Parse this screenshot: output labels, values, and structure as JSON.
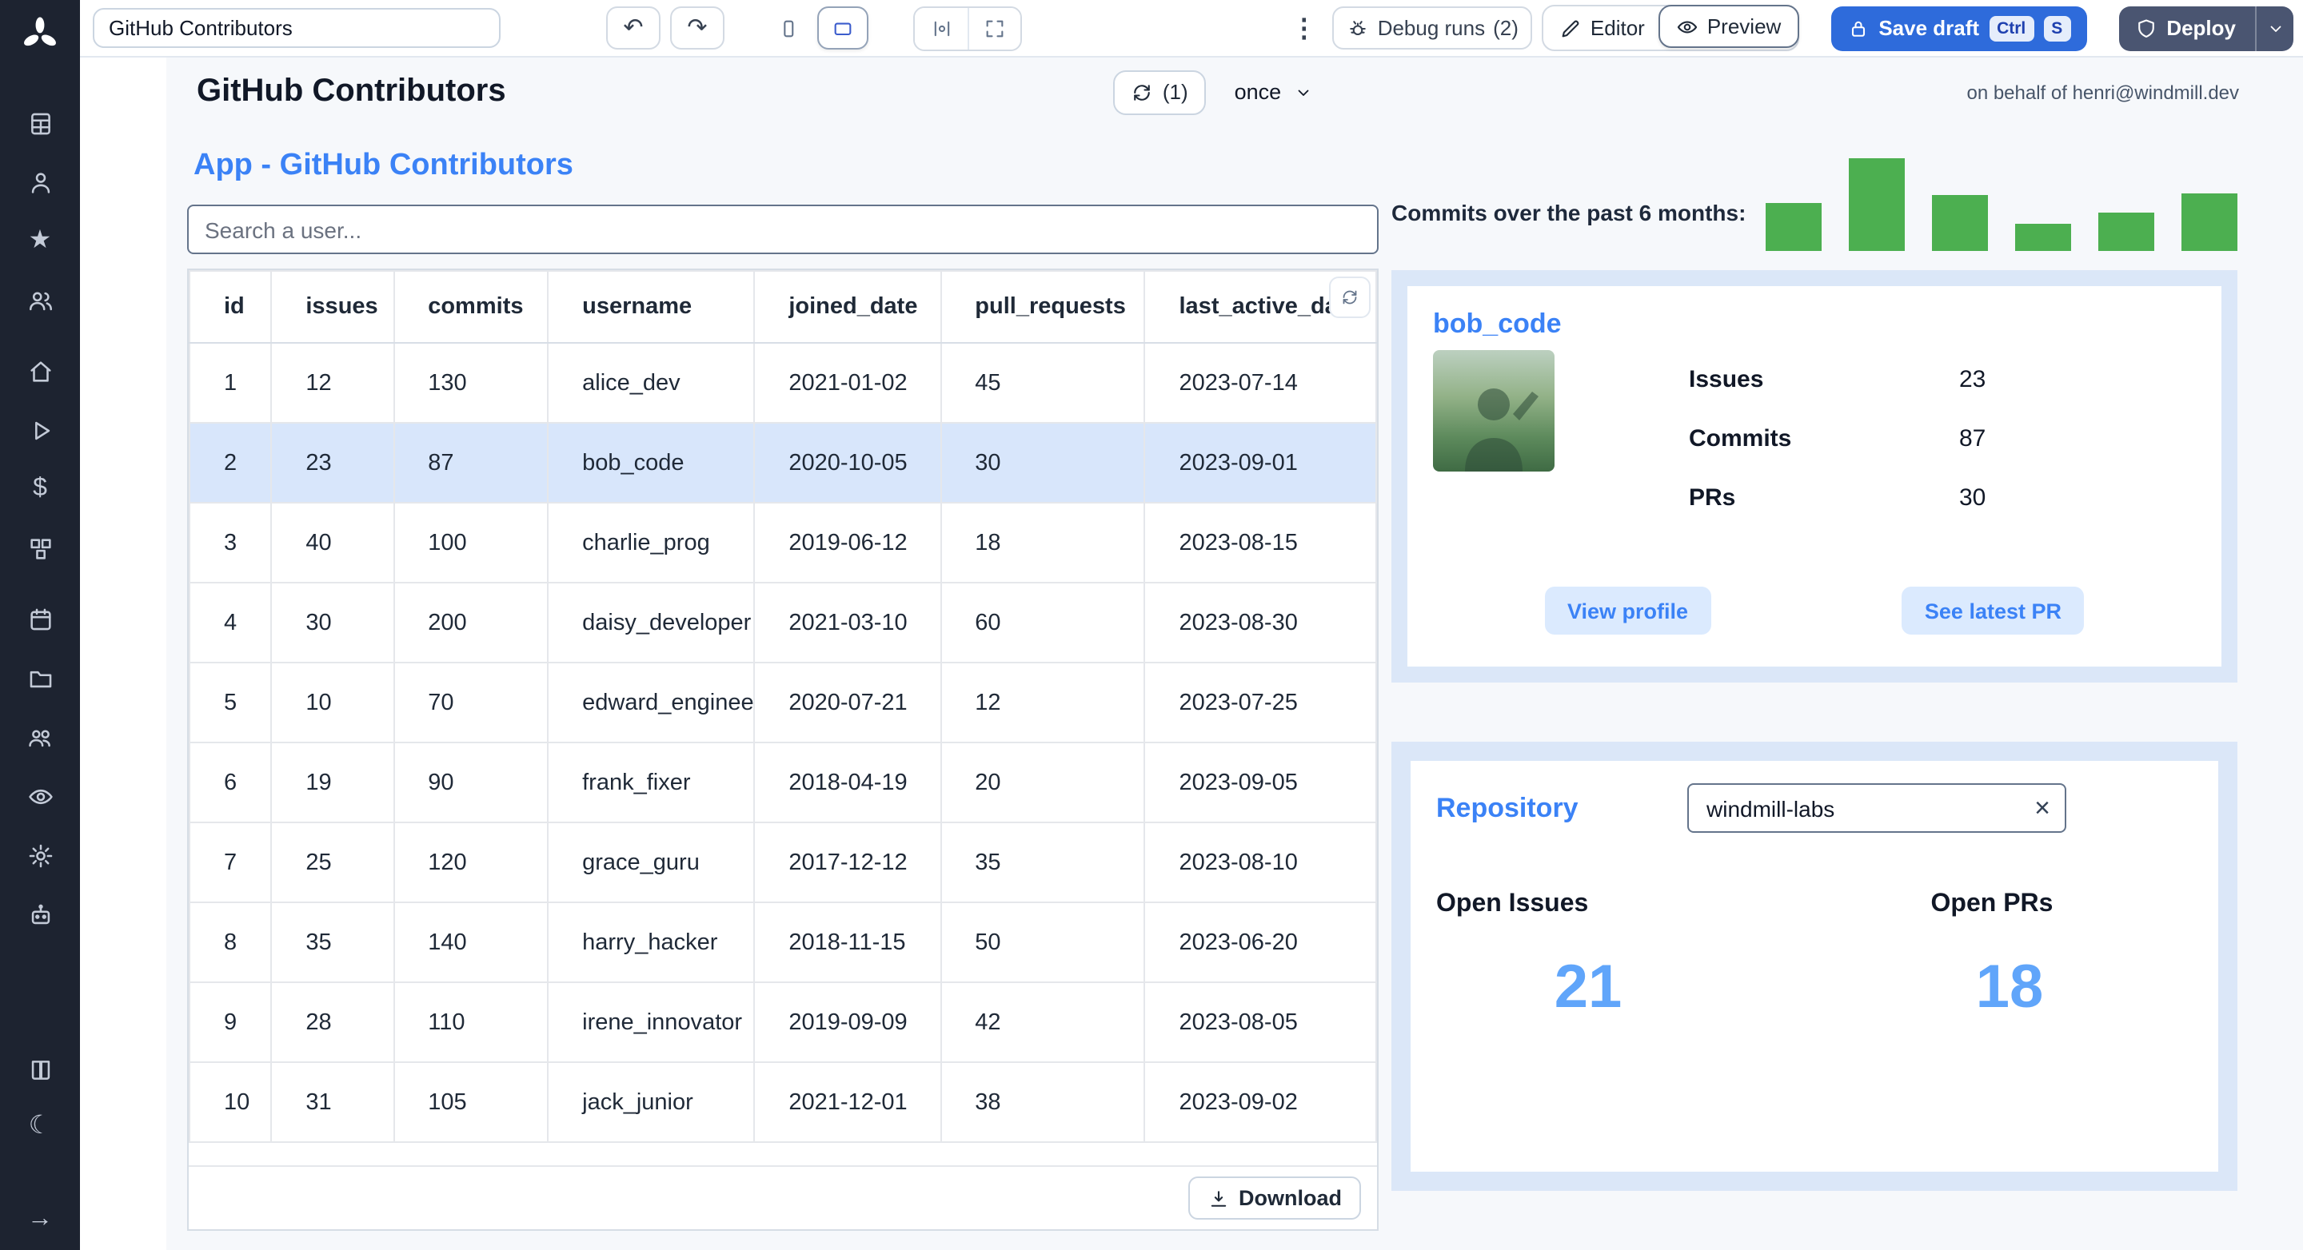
{
  "toolbar": {
    "app_title_value": "GitHub Contributors",
    "debug_runs_label": "Debug runs",
    "debug_runs_count": "(2)",
    "editor_label": "Editor",
    "preview_label": "Preview",
    "save_draft_label": "Save draft",
    "kbd_ctrl": "Ctrl",
    "kbd_s": "S",
    "deploy_label": "Deploy"
  },
  "header": {
    "title": "GitHub Contributors",
    "refresh_count": "(1)",
    "schedule_label": "once",
    "on_behalf": "on behalf of henri@windmill.dev"
  },
  "main": {
    "section_title": "App - GitHub Contributors",
    "search_placeholder": "Search a user...",
    "download_label": "Download"
  },
  "table": {
    "columns": [
      "id",
      "issues",
      "commits",
      "username",
      "joined_date",
      "pull_requests",
      "last_active_date"
    ],
    "selected_row_index": 1,
    "rows": [
      [
        "1",
        "12",
        "130",
        "alice_dev",
        "2021-01-02",
        "45",
        "2023-07-14"
      ],
      [
        "2",
        "23",
        "87",
        "bob_code",
        "2020-10-05",
        "30",
        "2023-09-01"
      ],
      [
        "3",
        "40",
        "100",
        "charlie_prog",
        "2019-06-12",
        "18",
        "2023-08-15"
      ],
      [
        "4",
        "30",
        "200",
        "daisy_developer",
        "2021-03-10",
        "60",
        "2023-08-30"
      ],
      [
        "5",
        "10",
        "70",
        "edward_engineer",
        "2020-07-21",
        "12",
        "2023-07-25"
      ],
      [
        "6",
        "19",
        "90",
        "frank_fixer",
        "2018-04-19",
        "20",
        "2023-09-05"
      ],
      [
        "7",
        "25",
        "120",
        "grace_guru",
        "2017-12-12",
        "35",
        "2023-08-10"
      ],
      [
        "8",
        "35",
        "140",
        "harry_hacker",
        "2018-11-15",
        "50",
        "2023-06-20"
      ],
      [
        "9",
        "28",
        "110",
        "irene_innovator",
        "2019-09-09",
        "42",
        "2023-08-05"
      ],
      [
        "10",
        "31",
        "105",
        "jack_junior",
        "2021-12-01",
        "38",
        "2023-09-02"
      ]
    ]
  },
  "chart_data": {
    "type": "bar",
    "title": "Commits over the past 6 months:",
    "values": [
      52,
      100,
      60,
      30,
      42,
      62
    ],
    "color": "#4caf50",
    "note": "relative monthly commit volume, no axis labels shown"
  },
  "contributor": {
    "username": "bob_code",
    "stats": [
      {
        "label": "Issues",
        "value": "23"
      },
      {
        "label": "Commits",
        "value": "87"
      },
      {
        "label": "PRs",
        "value": "30"
      }
    ],
    "view_profile_label": "View profile",
    "see_latest_pr_label": "See latest PR"
  },
  "repository": {
    "title": "Repository",
    "input_value": "windmill-labs",
    "open_issues_label": "Open Issues",
    "open_issues_value": "21",
    "open_prs_label": "Open PRs",
    "open_prs_value": "18"
  },
  "icons": {
    "undo": "↶",
    "redo": "↷",
    "kebab": "⋮",
    "close": "×",
    "star": "★",
    "dollar": "$",
    "moon": "☾",
    "arrow_right": "→"
  }
}
